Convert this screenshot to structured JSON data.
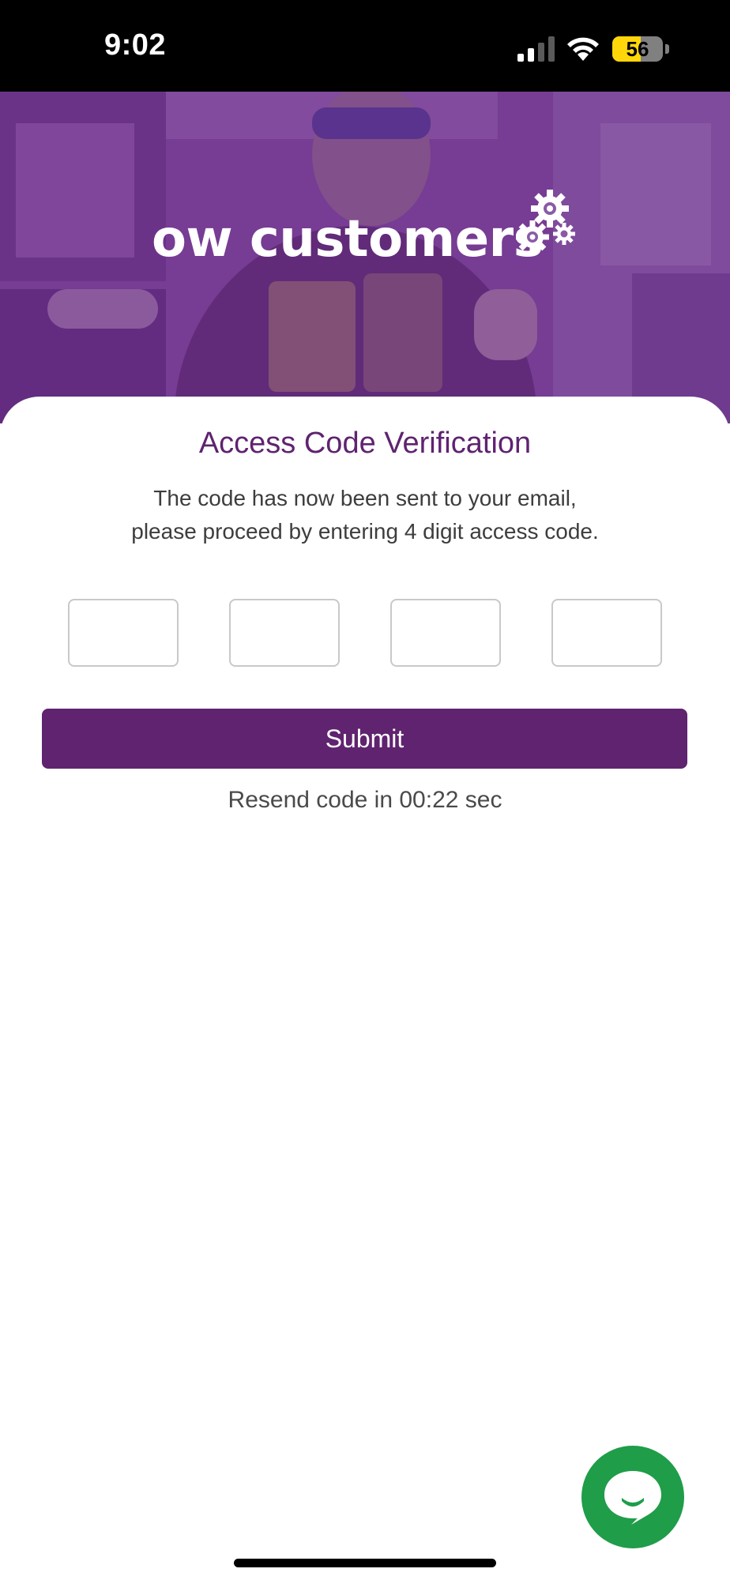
{
  "status_bar": {
    "time": "9:02",
    "battery_level": "56",
    "battery_fraction": 0.56,
    "signal_bars_active": 2,
    "signal_bars_total": 4
  },
  "hero": {
    "brand_text": "ow customers",
    "brand_icon": "gears-icon"
  },
  "form": {
    "title": "Access Code Verification",
    "description_line1": "The code has now been sent to your email,",
    "description_line2": "please proceed by entering 4 digit access code.",
    "code_digits": [
      "",
      "",
      "",
      ""
    ],
    "submit_label": "Submit",
    "resend_text": "Resend code in 00:22 sec"
  },
  "chat": {
    "icon": "chat-bubble-icon"
  },
  "colors": {
    "brand_purple": "#5f236f",
    "chat_green": "#1f9d49",
    "battery_yellow": "#ffd60a"
  }
}
